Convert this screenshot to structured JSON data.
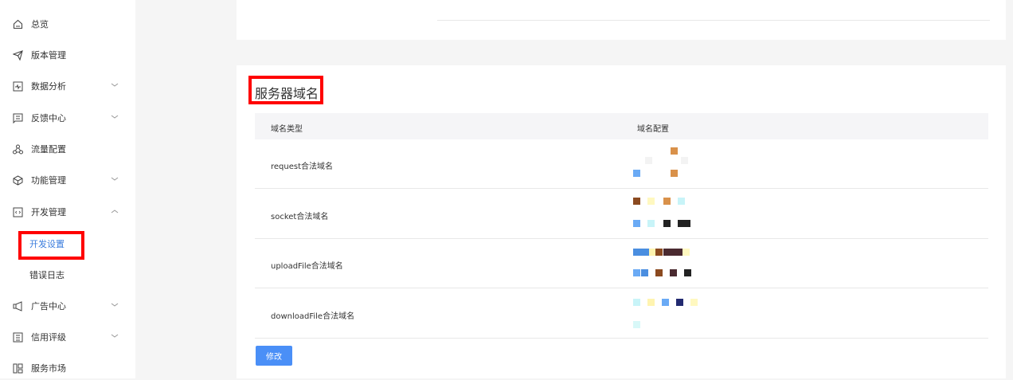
{
  "sidebar": {
    "items": [
      {
        "label": "总览",
        "icon": "home-icon",
        "chevron": ""
      },
      {
        "label": "版本管理",
        "icon": "send-icon",
        "chevron": ""
      },
      {
        "label": "数据分析",
        "icon": "chart-icon",
        "chevron": "down"
      },
      {
        "label": "反馈中心",
        "icon": "message-icon",
        "chevron": "down"
      },
      {
        "label": "流量配置",
        "icon": "nodes-icon",
        "chevron": ""
      },
      {
        "label": "功能管理",
        "icon": "cube-icon",
        "chevron": "down"
      },
      {
        "label": "开发管理",
        "icon": "code-icon",
        "chevron": "up"
      },
      {
        "label": "广告中心",
        "icon": "megaphone-icon",
        "chevron": "down"
      },
      {
        "label": "信用评级",
        "icon": "document-icon",
        "chevron": "down"
      },
      {
        "label": "服务市场",
        "icon": "grid-icon",
        "chevron": ""
      }
    ],
    "subitems": [
      {
        "label": "开发设置",
        "active": true
      },
      {
        "label": "错误日志",
        "active": false
      }
    ]
  },
  "section": {
    "title": "服务器域名",
    "columns": [
      "域名类型",
      "域名配置"
    ],
    "rows": [
      {
        "type": "request合法域名"
      },
      {
        "type": "socket合法域名"
      },
      {
        "type": "uploadFile合法域名"
      },
      {
        "type": "downloadFile合法域名"
      }
    ],
    "edit_button": "修改"
  },
  "colors": {
    "accent": "#4a8ff7",
    "highlight": "#ff0000"
  }
}
